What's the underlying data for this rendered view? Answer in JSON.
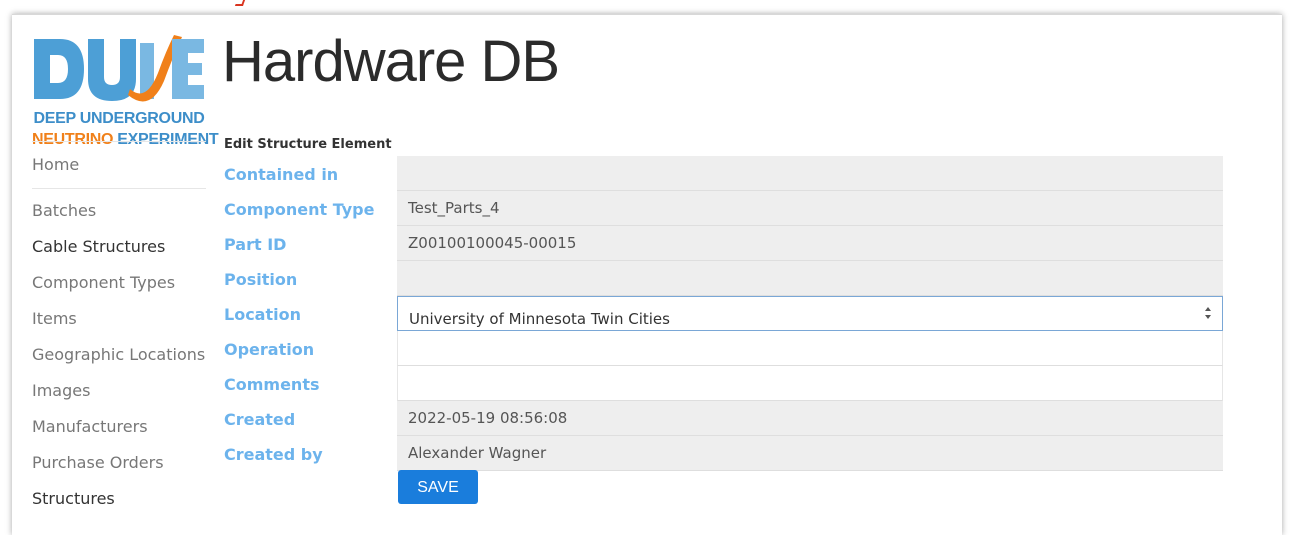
{
  "app": {
    "title": "Hardware DB",
    "logo_text": "DUNE",
    "logo_line1": "DEEP UNDERGROUND",
    "logo_line2_a": "NEUTRINO",
    "logo_line2_b": " EXPERIMENT"
  },
  "colors": {
    "label": "#6cb3ec",
    "button": "#1a7ddc",
    "logo_blue": "#3d8ec9",
    "logo_orange": "#f0801a"
  },
  "sidebar": {
    "items": [
      {
        "label": "Home"
      },
      {
        "label": "Batches"
      },
      {
        "label": "Cable Structures"
      },
      {
        "label": "Component Types"
      },
      {
        "label": "Items"
      },
      {
        "label": "Geographic Locations"
      },
      {
        "label": "Images"
      },
      {
        "label": "Manufacturers"
      },
      {
        "label": "Purchase Orders"
      },
      {
        "label": "Structures"
      }
    ]
  },
  "form": {
    "title": "Edit Structure Element",
    "rows": [
      {
        "label": "Contained in",
        "value": ""
      },
      {
        "label": "Component Type",
        "value": "Test_Parts_4"
      },
      {
        "label": "Part ID",
        "value": "Z00100100045-00015"
      },
      {
        "label": "Position",
        "value": ""
      },
      {
        "label": "Location",
        "value": "University of Minnesota Twin Cities"
      },
      {
        "label": "Operation",
        "value": ""
      },
      {
        "label": "Comments",
        "value": ""
      },
      {
        "label": "Created",
        "value": "2022-05-19 08:56:08"
      },
      {
        "label": "Created by",
        "value": "Alexander Wagner"
      }
    ],
    "save_label": "SAVE"
  }
}
